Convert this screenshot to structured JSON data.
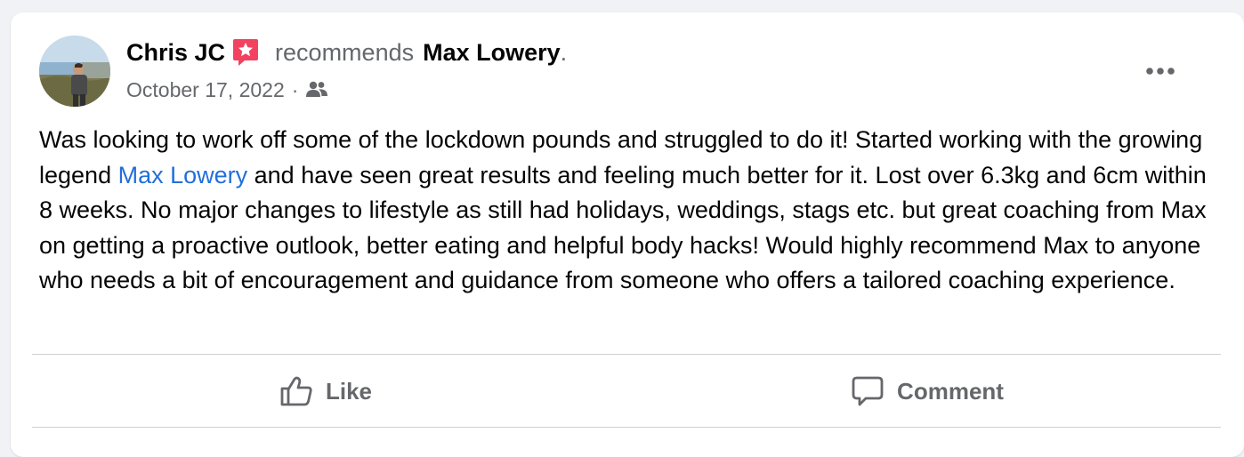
{
  "post": {
    "author": "Chris JC",
    "verb": "recommends",
    "page": "Max Lowery",
    "period": ".",
    "date": "October 17, 2022",
    "separator": "·",
    "icons": {
      "avatar": "profile-photo",
      "badge": "recommendation-star-icon",
      "audience": "friends-icon",
      "more": "more-horizontal-icon"
    },
    "body": {
      "part1": "Was looking to work off some of the lockdown pounds and struggled to do it! Started working with the growing legend ",
      "mention": "Max Lowery",
      "part2": " and have seen great results and feeling much better for it. Lost over 6.3kg and 6cm within 8 weeks. No major changes to lifestyle as still had holidays, weddings, stags etc. but great coaching from Max on getting a proactive outlook, better eating and helpful body hacks! Would highly recommend Max to anyone who needs a bit of encouragement and guidance from someone who offers a tailored coaching experience."
    }
  },
  "actions": {
    "like_label": "Like",
    "comment_label": "Comment"
  },
  "colors": {
    "link": "#216fdb",
    "badge": "#f3425f",
    "secondary_text": "#65676b",
    "primary_text": "#050505"
  }
}
